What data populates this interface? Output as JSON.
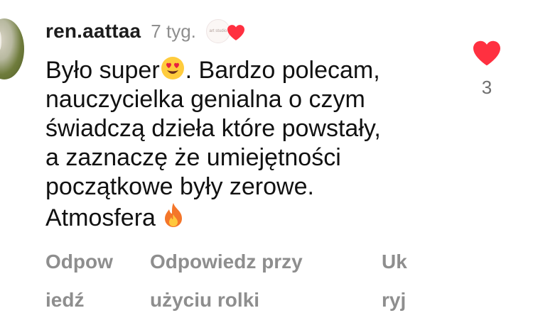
{
  "comment": {
    "username": "ren.aattaa",
    "timestamp": "7 tyg.",
    "creator_avatar_text": "art studio",
    "text_lines": [
      "Było super",
      ". Bardzo polecam,",
      "nauczycielka genialna o czym",
      "świadczą dzieła które powstały,",
      "a zaznaczę że umiejętności",
      "początkowe były zerowe.",
      "Atmosfera"
    ],
    "like_count": "3"
  },
  "actions": {
    "reply": [
      "Odpow",
      "iedź"
    ],
    "reply_with_reel": [
      "Odpowiedz przy",
      "użyciu rolki"
    ],
    "hide": [
      "Uk",
      "ryj"
    ]
  },
  "colors": {
    "like_red": "#ff3040",
    "muted_text": "#8e8e8e",
    "primary_text": "#111111"
  },
  "icons": {
    "avatar": "profile-photo",
    "creator_heart": "heart-icon",
    "emoji_heart_eyes": "heart-eyes-emoji",
    "emoji_fire": "fire-emoji",
    "like": "heart-icon"
  }
}
